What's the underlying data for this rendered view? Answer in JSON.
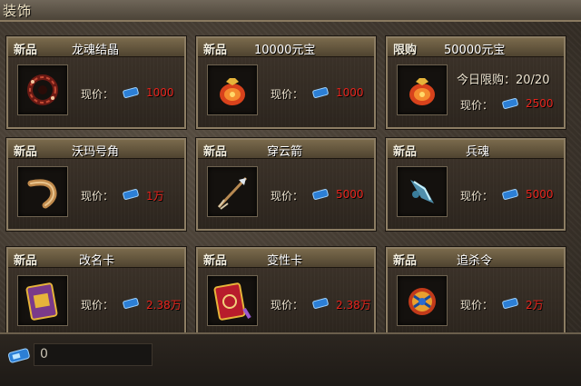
{
  "window": {
    "title": "装饰"
  },
  "currency_icon": "blue-gem-ticket-icon",
  "colors": {
    "price": "#e8231c",
    "frame": "#8c7d63"
  },
  "items": [
    {
      "tag": "新品",
      "name": "龙魂结晶",
      "price_label": "现价：",
      "price": "1000",
      "icon": "dragon-soul-crystal-icon"
    },
    {
      "tag": "新品",
      "name": "10000元宝",
      "price_label": "现价：",
      "price": "1000",
      "icon": "red-money-bag-icon"
    },
    {
      "tag": "限购",
      "name": "50000元宝",
      "limit_text": "今日限购：20/20",
      "price_label": "现价：",
      "price": "2500",
      "icon": "red-money-bag-icon"
    },
    {
      "tag": "新品",
      "name": "沃玛号角",
      "price_label": "现价：",
      "price": "1万",
      "icon": "woma-horn-icon"
    },
    {
      "tag": "新品",
      "name": "穿云箭",
      "price_label": "现价：",
      "price": "5000",
      "icon": "arrow-icon"
    },
    {
      "tag": "新品",
      "name": "兵魂",
      "price_label": "现价：",
      "price": "5000",
      "icon": "weapon-soul-icon"
    },
    {
      "tag": "新品",
      "name": "改名卡",
      "price_label": "现价：",
      "price": "2.38万",
      "icon": "rename-card-icon"
    },
    {
      "tag": "新品",
      "name": "变性卡",
      "price_label": "现价：",
      "price": "2.38万",
      "icon": "gender-change-card-icon"
    },
    {
      "tag": "新品",
      "name": "追杀令",
      "price_label": "现价：",
      "price": "2万",
      "icon": "hunt-order-icon"
    }
  ],
  "footer": {
    "balance": "0"
  }
}
